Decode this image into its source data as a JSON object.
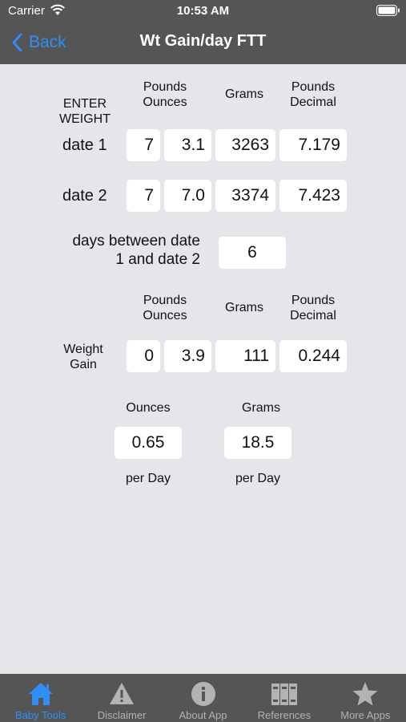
{
  "status": {
    "carrier": "Carrier",
    "time": "10:53 AM"
  },
  "nav": {
    "back_label": "Back",
    "title": "Wt Gain/day FTT"
  },
  "enter_weight": {
    "label_line1": "ENTER",
    "label_line2": "WEIGHT"
  },
  "headers": {
    "pounds_ounces_line1": "Pounds",
    "pounds_ounces_line2": "Ounces",
    "grams": "Grams",
    "pounds_decimal_line1": "Pounds",
    "pounds_decimal_line2": "Decimal"
  },
  "date1": {
    "label": "date 1",
    "pounds": "7",
    "ounces": "3.1",
    "grams": "3263",
    "decimal": "7.179"
  },
  "date2": {
    "label": "date 2",
    "pounds": "7",
    "ounces": "7.0",
    "grams": "3374",
    "decimal": "7.423"
  },
  "days_between": {
    "label_line1": "days between date",
    "label_line2": "1 and date 2",
    "value": "6"
  },
  "weight_gain": {
    "label_line1": "Weight",
    "label_line2": "Gain",
    "pounds": "0",
    "ounces": "3.9",
    "grams": "111",
    "decimal": "0.244"
  },
  "per_day": {
    "ounces_header": "Ounces",
    "grams_header": "Grams",
    "ounces_value": "0.65",
    "grams_value": "18.5",
    "ounces_footer": "per Day",
    "grams_footer": "per Day"
  },
  "tabs": [
    {
      "label": "Baby Tools",
      "icon": "house-icon",
      "active": true
    },
    {
      "label": "Disclaimer",
      "icon": "warning-icon",
      "active": false
    },
    {
      "label": "About App",
      "icon": "info-icon",
      "active": false
    },
    {
      "label": "References",
      "icon": "books-icon",
      "active": false
    },
    {
      "label": "More Apps",
      "icon": "star-icon",
      "active": false
    }
  ],
  "colors": {
    "bar_bg": "#555556",
    "page_bg": "#e6e6ea",
    "accent": "#2f8ff5",
    "tab_inactive": "#b3b3b3"
  }
}
